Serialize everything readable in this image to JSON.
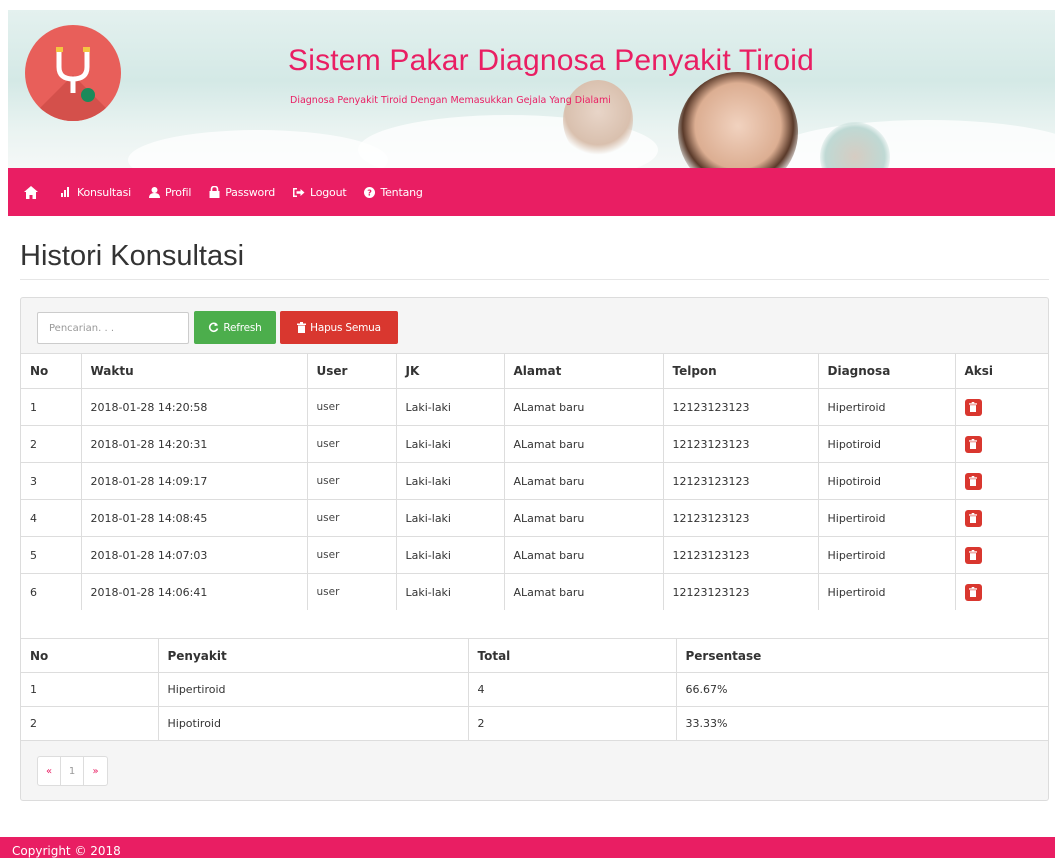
{
  "header": {
    "title": "Sistem Pakar Diagnosa Penyakit Tiroid",
    "subtitle": "Diagnosa Penyakit Tiroid Dengan Memasukkan Gejala Yang Dialami"
  },
  "nav": {
    "items": [
      {
        "label": "Konsultasi",
        "icon": "bar-chart-icon"
      },
      {
        "label": "Profil",
        "icon": "user-icon"
      },
      {
        "label": "Password",
        "icon": "lock-icon"
      },
      {
        "label": "Logout",
        "icon": "logout-icon"
      },
      {
        "label": "Tentang",
        "icon": "question-circle-icon"
      }
    ]
  },
  "page": {
    "title": "Histori Konsultasi"
  },
  "toolbar": {
    "search_placeholder": "Pencarian. . .",
    "refresh_label": "Refresh",
    "delete_all_label": "Hapus Semua"
  },
  "history": {
    "headers": [
      "No",
      "Waktu",
      "User",
      "JK",
      "Alamat",
      "Telpon",
      "Diagnosa",
      "Aksi"
    ],
    "rows": [
      [
        "1",
        "2018-01-28 14:20:58",
        "user",
        "Laki-laki",
        "ALamat baru",
        "12123123123",
        "Hipertiroid"
      ],
      [
        "2",
        "2018-01-28 14:20:31",
        "user",
        "Laki-laki",
        "ALamat baru",
        "12123123123",
        "Hipotiroid"
      ],
      [
        "3",
        "2018-01-28 14:09:17",
        "user",
        "Laki-laki",
        "ALamat baru",
        "12123123123",
        "Hipotiroid"
      ],
      [
        "4",
        "2018-01-28 14:08:45",
        "user",
        "Laki-laki",
        "ALamat baru",
        "12123123123",
        "Hipertiroid"
      ],
      [
        "5",
        "2018-01-28 14:07:03",
        "user",
        "Laki-laki",
        "ALamat baru",
        "12123123123",
        "Hipertiroid"
      ],
      [
        "6",
        "2018-01-28 14:06:41",
        "user",
        "Laki-laki",
        "ALamat baru",
        "12123123123",
        "Hipertiroid"
      ]
    ]
  },
  "summary": {
    "headers": [
      "No",
      "Penyakit",
      "Total",
      "Persentase"
    ],
    "rows": [
      [
        "1",
        "Hipertiroid",
        "4",
        "66.67%"
      ],
      [
        "2",
        "Hipotiroid",
        "2",
        "33.33%"
      ]
    ]
  },
  "pagination": {
    "prev": "«",
    "current": "1",
    "next": "»"
  },
  "footer": {
    "text": "Copyright © 2018"
  },
  "colors": {
    "brand": "#e91e63",
    "success": "#4cae4c",
    "danger": "#d9372f"
  }
}
